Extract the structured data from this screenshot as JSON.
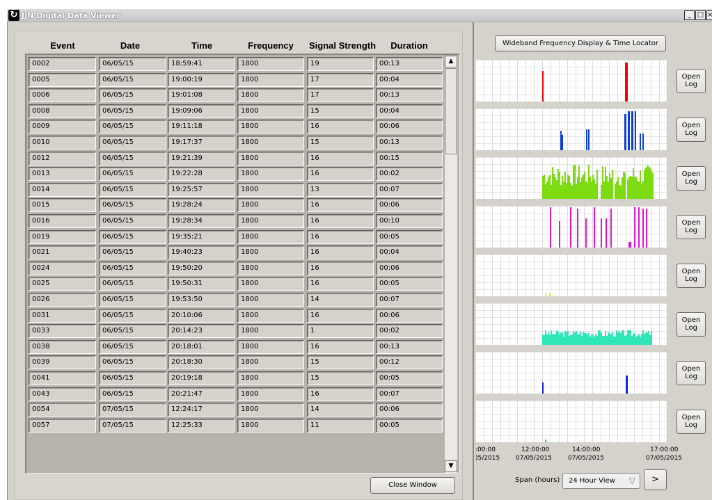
{
  "window": {
    "title": "JJN Digital Data Viewer",
    "app_icon": "refresh-icon",
    "minimize": "_",
    "maximize": "□",
    "close": "×"
  },
  "table": {
    "headers": [
      "Event",
      "Date",
      "Time",
      "Frequency",
      "Signal Strength",
      "Duration"
    ],
    "rows": [
      [
        "0002",
        "06/05/15",
        "18:59:41",
        "1800",
        "19",
        "00:13"
      ],
      [
        "0005",
        "06/05/15",
        "19:00:19",
        "1800",
        "17",
        "00:04"
      ],
      [
        "0006",
        "06/05/15",
        "19:01:08",
        "1800",
        "17",
        "00:13"
      ],
      [
        "0008",
        "06/05/15",
        "19:09:06",
        "1800",
        "15",
        "00:04"
      ],
      [
        "0009",
        "06/05/15",
        "19:11:18",
        "1800",
        "16",
        "00:06"
      ],
      [
        "0010",
        "06/05/15",
        "19:17:37",
        "1800",
        "15",
        "00:13"
      ],
      [
        "0012",
        "06/05/15",
        "19:21:39",
        "1800",
        "16",
        "00:15"
      ],
      [
        "0013",
        "06/05/15",
        "19:22:28",
        "1800",
        "16",
        "00:02"
      ],
      [
        "0014",
        "06/05/15",
        "19:25:57",
        "1800",
        "13",
        "00:07"
      ],
      [
        "0015",
        "06/05/15",
        "19:28:24",
        "1800",
        "16",
        "00:06"
      ],
      [
        "0016",
        "06/05/15",
        "19:28:34",
        "1800",
        "16",
        "00:10"
      ],
      [
        "0019",
        "06/05/15",
        "19:35:21",
        "1800",
        "16",
        "00:05"
      ],
      [
        "0021",
        "06/05/15",
        "19:40:23",
        "1800",
        "16",
        "00:04"
      ],
      [
        "0024",
        "06/05/15",
        "19:50:20",
        "1800",
        "16",
        "00:06"
      ],
      [
        "0025",
        "06/05/15",
        "19:50:31",
        "1800",
        "16",
        "00:05"
      ],
      [
        "0026",
        "06/05/15",
        "19:53:50",
        "1800",
        "14",
        "00:07"
      ],
      [
        "0031",
        "06/05/15",
        "20:10:06",
        "1800",
        "16",
        "00:06"
      ],
      [
        "0033",
        "06/05/15",
        "20:14:23",
        "1800",
        "1",
        "00:02"
      ],
      [
        "0038",
        "06/05/15",
        "20:18:01",
        "1800",
        "16",
        "00:13"
      ],
      [
        "0039",
        "06/05/15",
        "20:18:30",
        "1800",
        "15",
        "00:12"
      ],
      [
        "0041",
        "06/05/15",
        "20:19:18",
        "1800",
        "15",
        "00:05"
      ],
      [
        "0043",
        "06/05/15",
        "20:21:47",
        "1800",
        "16",
        "00:07"
      ],
      [
        "0054",
        "07/05/15",
        "12:24:17",
        "1800",
        "14",
        "00:06"
      ],
      [
        "0057",
        "07/05/15",
        "12:25:33",
        "1800",
        "11",
        "00:05"
      ]
    ],
    "scroll_up": "▲",
    "scroll_down": "▼"
  },
  "close_button": "Close Window",
  "right": {
    "wideband_button": "Wideband Frequency Display & Time Locator",
    "open_log_line1": "Open",
    "open_log_line2": "Log",
    "tracks": [
      {
        "color": "#ff0000",
        "kind": "red"
      },
      {
        "color": "#0b3fd0",
        "kind": "blue"
      },
      {
        "color": "#7ddb12",
        "kind": "green"
      },
      {
        "color": "#e014d0",
        "kind": "magenta"
      },
      {
        "color": "#f5e600",
        "kind": "yellow"
      },
      {
        "color": "#2ee6b8",
        "kind": "teal"
      },
      {
        "color": "#0a28d6",
        "kind": "blue2"
      },
      {
        "color": "#19c97a",
        "kind": "green2"
      }
    ],
    "axis": {
      "t1": ":00:00",
      "d1": ")5/2015",
      "t2": "12:00:00",
      "d2": "07/05/2015",
      "t3": "14:00:00",
      "d3": "07/05/2015",
      "t4": "17:00:00",
      "d4": "07/05/2015"
    },
    "span_label": "Span (hours)",
    "span_value": "24 Hour View",
    "next_button": ">"
  }
}
